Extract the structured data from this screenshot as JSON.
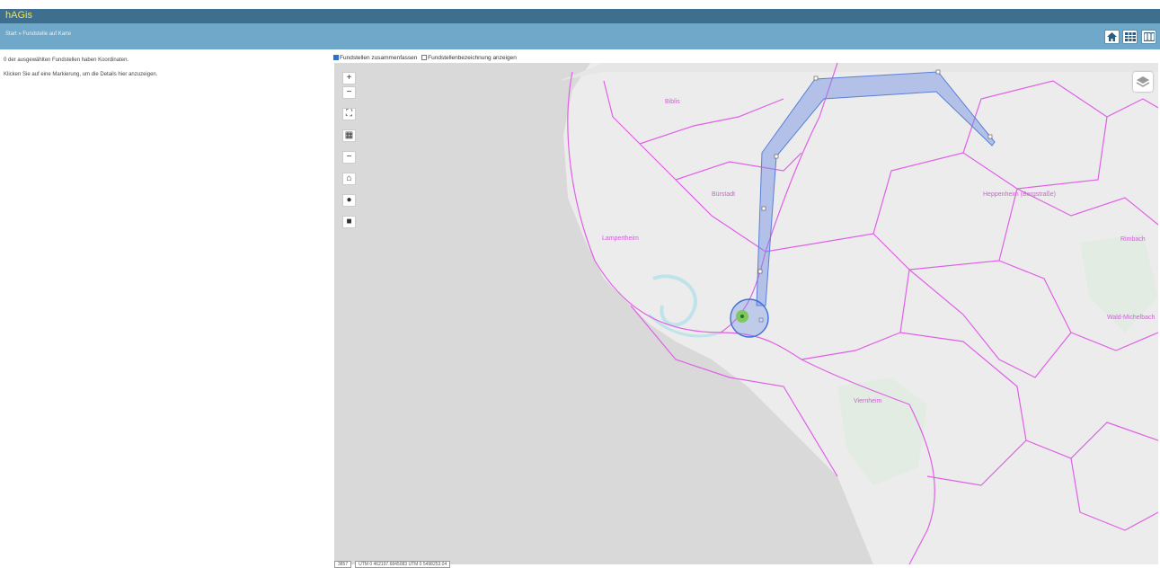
{
  "app": {
    "title": "hAGis"
  },
  "breadcrumb": {
    "start": "Start",
    "separator": " » ",
    "current": "Fundstelle auf Karte"
  },
  "header_buttons": [
    {
      "icon": "home-icon"
    },
    {
      "icon": "table-icon"
    },
    {
      "icon": "map-icon"
    }
  ],
  "sidebar": {
    "line1": "0 der ausgewählten Fundstellen haben Koordinaten.",
    "line2": "Klicken Sie auf eine Markierung, um die Details hier anzuzeigen."
  },
  "map_options": {
    "merge_label": "Fundstellen zusammenfassen",
    "merge_checked": true,
    "show_name_label": "Fundstellenbezeichnung anzeigen",
    "show_name_checked": false
  },
  "map": {
    "controls": [
      {
        "name": "zoom-in-button",
        "glyph": "+"
      },
      {
        "name": "zoom-out-button",
        "glyph": "−"
      },
      {
        "name": "fullscreen-button",
        "glyph": "⛶"
      },
      {
        "name": "measure-button",
        "glyph": "▦"
      },
      {
        "name": "minus-button",
        "glyph": "−"
      },
      {
        "name": "home-view-button",
        "glyph": "⌂"
      },
      {
        "name": "locate-button",
        "glyph": "●"
      },
      {
        "name": "delete-button",
        "glyph": "■"
      }
    ],
    "labels": [
      "Lampertheim",
      "Bürstadt",
      "Biblis",
      "Viernheim",
      "Heppenheim (Bergstraße)",
      "Wald-Michelbach",
      "Rimbach"
    ]
  },
  "footer": {
    "projection": "3857",
    "coordinates": "UTM 0 462197.6845083 UTM 0 5498253.04"
  },
  "colors": {
    "topbar": "#3e6f8e",
    "breadbar": "#6fa8c8",
    "boundary": "#e060e6",
    "route": "#6f8fe6"
  }
}
